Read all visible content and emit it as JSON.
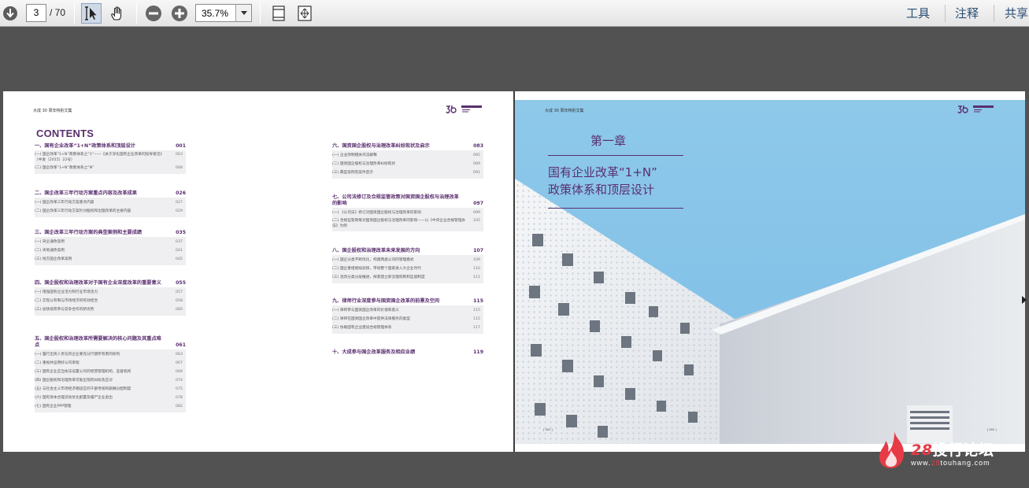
{
  "toolbar": {
    "page_current": "3",
    "page_total": "/ 70",
    "zoom": "35.7%",
    "menu": {
      "tools": "工具",
      "comment": "注释",
      "share": "共享"
    }
  },
  "left_page": {
    "header": "大成 30 周年特别文集",
    "contents_title": "CONTENTS",
    "sections_left": [
      {
        "title": "一、国有企业改革“1+N”政策体系和顶层设计",
        "page": "001",
        "items": [
          {
            "label": "(一)  国企改革“1+N”政策体系之“1”——《关于深化国有企业改革的指导意见》（中发〔2015〕22号）",
            "page": "003",
            "two": true
          },
          {
            "label": "(二)  国企改革“1+N”政策体系之“N”",
            "page": "008"
          }
        ]
      },
      {
        "title": "二、国企改革三年行动方案重点内容及改革成果",
        "page": "026",
        "items": [
          {
            "label": "(一)  国企改革三年行动方案重点内容",
            "page": "027"
          },
          {
            "label": "(二)  国企改革三年行动方案针对股权和治理改革的主要内容",
            "page": "029"
          }
        ]
      },
      {
        "title": "三、国企改革三年行动方案的典型案例和主要成绩",
        "page": "035",
        "items": [
          {
            "label": "(一)  央企通改案例",
            "page": "037"
          },
          {
            "label": "(二)  央地通改案例",
            "page": "041"
          },
          {
            "label": "(三)  地方国企改革案例",
            "page": "045"
          }
        ]
      },
      {
        "title": "四、国企股权和治理改革对于国有企业深度改革的重要意义",
        "page": "055",
        "items": [
          {
            "label": "(一)  增强国有企业活力和行业市场活力",
            "page": "057"
          },
          {
            "label": "(二)  实现公有制与市场经济的有效结合",
            "page": "058"
          },
          {
            "label": "(三)  加快培育参与竞争合作的新优势",
            "page": "060"
          }
        ]
      },
      {
        "title": "五、国企股权和治理改革所需要解决的核心问题及其重点难点",
        "page": "061",
        "items": [
          {
            "label": "(一)  履行出资人责任的企业要充分行使所有者的权利",
            "page": "063"
          },
          {
            "label": "(二)  重视并运用好公司章程",
            "page": "067"
          },
          {
            "label": "(三)  国有企业应当依法设置公司的经营管理机构、监督机构",
            "page": "068"
          },
          {
            "label": "(四)  国企股权和治理改革可能出现的纠纷及应对",
            "page": "074"
          },
          {
            "label": "(五)  与社会主义市场经济相适应的干部考核和薪酬分配制度",
            "page": "075"
          },
          {
            "label": "(六)  国有资本合理流动优化配置及僵尸企业退出",
            "page": "078"
          },
          {
            "label": "(七)  国有企业PPP管理",
            "page": "082"
          }
        ]
      }
    ],
    "sections_right": [
      {
        "title": "六、国资国企股权与治理改革纠纷现状及启示",
        "page": "083",
        "items": [
          {
            "label": "(一)  企业改制相关司法解释",
            "page": "085"
          },
          {
            "label": "(二)  国资国企股权与治理改革纠纷现状",
            "page": "089"
          },
          {
            "label": "(三)  典型案例及案件启示",
            "page": "091"
          }
        ]
      },
      {
        "title": "七、公司法修订及合规监管政策对国资国企股权与治理改革的影响",
        "page": "097",
        "items": [
          {
            "label": "(一)  《公司法》修订对国资国企股权与治理改革的影响",
            "page": "099"
          },
          {
            "label": "(二)  合规监管政策对国资国企股权与治理改革的影响——以《中央企业合规管理办法》为例",
            "page": "105",
            "two": true
          }
        ]
      },
      {
        "title": "八、国企股权和治理改革未来发展的方向",
        "page": "107",
        "items": [
          {
            "label": "(一)  国企分类不断优化，构建两类公司的管理模式",
            "page": "109"
          },
          {
            "label": "(二)  国企重组继续加快，带动整个国家进入大企业时代",
            "page": "110"
          },
          {
            "label": "(三)  混改分类分层推进，探索建立新治理机制和监督制度",
            "page": "111"
          }
        ]
      },
      {
        "title": "九、律师行业深度参与国资国企改革的前景及空间",
        "page": "115",
        "items": [
          {
            "label": "(一)  律师参与国资国企改革的价值和意义",
            "page": "115"
          },
          {
            "label": "(二)  律师在国资国企改革中提供法律服务的类型",
            "page": "115"
          },
          {
            "label": "(三)  协助国有企业建设合规管理体系",
            "page": "117"
          }
        ]
      },
      {
        "title": "十、大成参与国企改革服务及相应业绩",
        "page": "119",
        "items": []
      }
    ]
  },
  "right_page": {
    "header": "大成 30 周年特别文集",
    "chapter_no": "第一章",
    "chapter_title_line1": "国有企业改革“1+N”",
    "chapter_title_line2": "政策体系和顶层设计",
    "page_mark_left": "[ 001 ]",
    "page_mark_right": "[ 002 ]"
  },
  "watermark": {
    "brand_num": "28",
    "brand_text": "投行论坛",
    "url_prefix": "www.",
    "url_hl": "28",
    "url_suffix": "touhang.com"
  },
  "colors": {
    "accent_purple": "#5a2f6f",
    "watermark_red": "#e63b46",
    "sky": "#86c2e6"
  }
}
